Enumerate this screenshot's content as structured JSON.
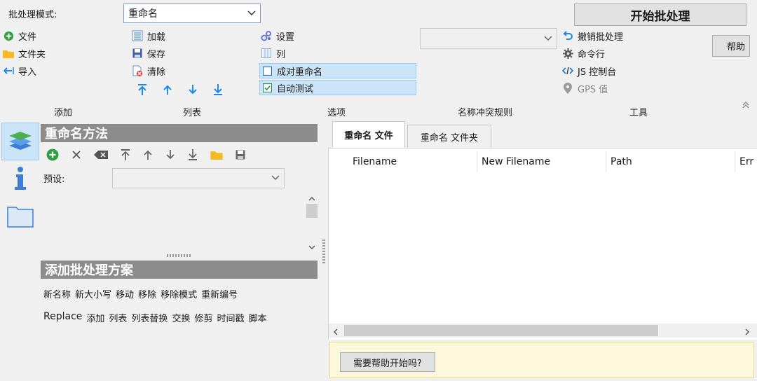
{
  "batch": {
    "mode_label": "批处理模式:",
    "mode_value": "重命名",
    "start_button": "开始批处理",
    "help_button": "帮助",
    "help_button_partial": "帮助"
  },
  "top_left": [
    {
      "label": "文件",
      "icon": "add-circle-icon"
    },
    {
      "label": "文件夹",
      "icon": "folder-icon"
    },
    {
      "label": "导入",
      "icon": "import-arrow-icon"
    }
  ],
  "top_mid": [
    {
      "label": "加载",
      "icon": "list-icon"
    },
    {
      "label": "保存",
      "icon": "save-icon"
    },
    {
      "label": "清除",
      "icon": "clear-icon"
    }
  ],
  "options": [
    {
      "label": "设置",
      "icon": "settings-icon"
    },
    {
      "label": "列",
      "icon": "columns-icon"
    },
    {
      "label": "成对重命名",
      "icon": "checkbox-unchecked-icon",
      "checked": false
    },
    {
      "label": "自动测试",
      "icon": "checkbox-checked-icon",
      "checked": true
    }
  ],
  "tools": [
    {
      "label": "撤销批处理",
      "icon": "undo-icon"
    },
    {
      "label": "命令行",
      "icon": "gear-icon"
    },
    {
      "label": "JS 控制台",
      "icon": "code-icon"
    },
    {
      "label": "GPS 值",
      "icon": "location-pin-icon",
      "disabled": true
    }
  ],
  "ribbon_groups": [
    "添加",
    "列表",
    "选项",
    "名称冲突规则",
    "工具"
  ],
  "rename_methods": {
    "title": "重命名方法",
    "preset_label": "预设:"
  },
  "add_scheme": {
    "title": "添加批处理方案",
    "row1": [
      "新名称",
      "新大小写",
      "移动",
      "移除",
      "移除模式",
      "重新编号"
    ],
    "row2": [
      "Replace",
      "添加",
      "列表",
      "列表替换",
      "交换",
      "修剪",
      "时间戳",
      "脚本"
    ]
  },
  "tabs": [
    "重命名 文件",
    "重命名 文件夹"
  ],
  "table": {
    "columns": [
      "Filename",
      "New Filename",
      "Path",
      "Err"
    ]
  },
  "help_bar": {
    "button": "需要帮助开始吗?"
  },
  "colors": {
    "accent_blue": "#1e88e5",
    "green": "#2ea043",
    "folder_yellow": "#f5b921",
    "section_gray": "#8c8c8c",
    "highlight": "#cce4f7",
    "help_bg": "#fdf8dc"
  }
}
